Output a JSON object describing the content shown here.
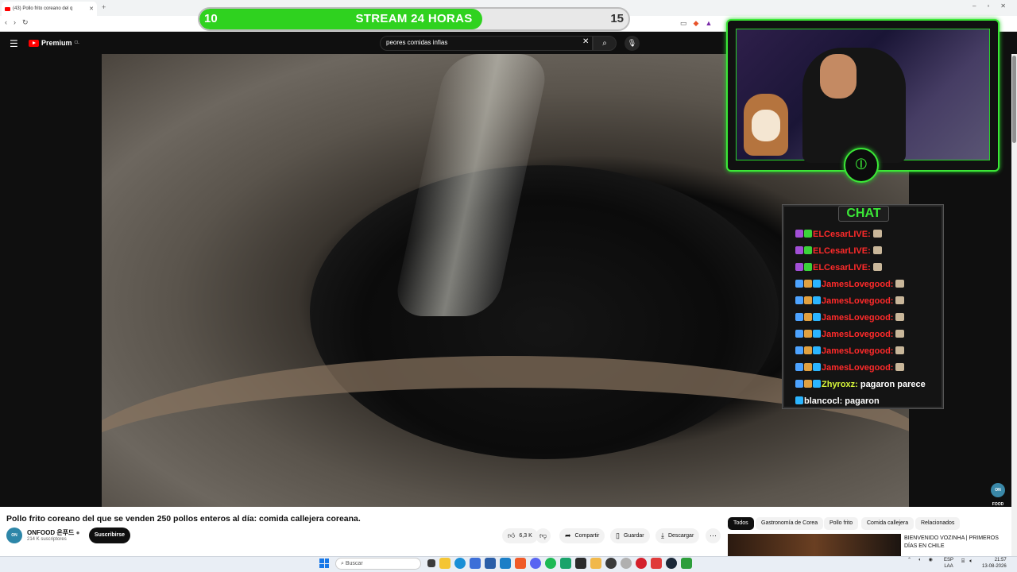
{
  "browser": {
    "tab_title": "(43) Pollo frito coreano del q",
    "new_tab": "+",
    "nav": [
      "‹",
      "›",
      "↻"
    ]
  },
  "banner": {
    "start": "10",
    "title": "STREAM 24 HORAS",
    "end": "15",
    "progress": 0.66,
    "fill_color": "#2fd21f"
  },
  "youtube": {
    "logo_text": "Premium",
    "logo_sup": "CL",
    "search_query": "peores comidas infias"
  },
  "video": {
    "channel_badge": "ON FOOD",
    "title": "Pollo frito coreano del que se venden 250 pollos enteros al día: comida callejera coreana.",
    "channel_name": "ONFOOD 온푸드",
    "subscribers": "214 K suscriptores",
    "subscribe": "Suscribirse",
    "likes": "6,3 K",
    "share": "Compartir",
    "save": "Guardar",
    "download": "Descargar"
  },
  "chips": [
    "Todos",
    "Gastronomía de Corea",
    "Pollo frito",
    "Comida callejera",
    "Relacionados"
  ],
  "recommended": {
    "title": "BIENVENIDO VOZINHA | PRIMEROS DÍAS EN CHILE"
  },
  "chat": {
    "title": "CHAT",
    "messages": [
      {
        "user": "ELCesarLIVE:",
        "text": "",
        "color": "#ff2a2a"
      },
      {
        "user": "ELCesarLIVE:",
        "text": "",
        "color": "#ff2a2a"
      },
      {
        "user": "ELCesarLIVE:",
        "text": "",
        "color": "#ff2a2a"
      },
      {
        "user": "JamesLovegood:",
        "text": "",
        "color": "#ff2a2a"
      },
      {
        "user": "JamesLovegood:",
        "text": "",
        "color": "#ff2a2a"
      },
      {
        "user": "JamesLovegood:",
        "text": "",
        "color": "#ff2a2a"
      },
      {
        "user": "JamesLovegood:",
        "text": "",
        "color": "#ff2a2a"
      },
      {
        "user": "JamesLovegood:",
        "text": "",
        "color": "#ff2a2a"
      },
      {
        "user": "JamesLovegood:",
        "text": "",
        "color": "#ff2a2a"
      },
      {
        "user": "Zhyroxz:",
        "text": "pagaron parece",
        "color": "#d6f53a"
      },
      {
        "user": "blancocl:",
        "text": "pagaron",
        "color": "#ffffff"
      }
    ]
  },
  "taskbar": {
    "search_placeholder": "Buscar",
    "lang_top": "ESP",
    "lang_bottom": "LAA",
    "time": "21:57",
    "date": "13-08-2026"
  }
}
